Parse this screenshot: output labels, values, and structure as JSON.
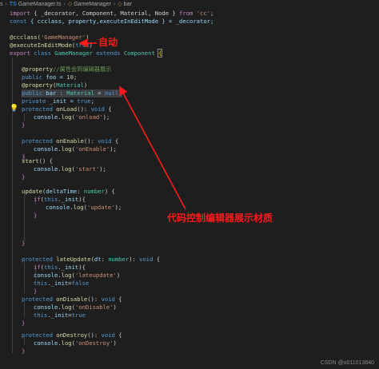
{
  "breadcrumb": {
    "items": [
      "s",
      "GameManager.ts",
      "GameManager",
      "bar"
    ],
    "ts_badge": "TS"
  },
  "code": {
    "l1": [
      "import",
      " { _decorator, Component, Material, Node } ",
      "from",
      " ",
      "'cc'",
      ";"
    ],
    "l2": [
      "const",
      " { ccclass, property,executeInEditMode } = _decorator;"
    ],
    "l4": [
      "@ccclass(",
      "'GameManager'",
      ")"
    ],
    "l5": [
      "@executeInEditMode(",
      "true",
      ")"
    ],
    "l6": [
      "export",
      " ",
      "class",
      " ",
      "GameManager",
      " ",
      "extends",
      " ",
      "Component",
      " ",
      "{"
    ],
    "l8": [
      "@property",
      "//属性会到编辑器展示"
    ],
    "l9": [
      "public",
      " foo = ",
      "10",
      ";"
    ],
    "l10": [
      "@property(",
      "Material",
      ")"
    ],
    "l11": [
      "public",
      " bar : ",
      "Material",
      " = ",
      "null",
      ";"
    ],
    "l12": [
      "private",
      " _init = ",
      "true",
      ";"
    ],
    "l13": [
      "protected",
      " ",
      "onLoad",
      "(): ",
      "void",
      " {"
    ],
    "l14": [
      "console",
      ".",
      "log",
      "(",
      "'onload'",
      ");"
    ],
    "l15": [
      "}"
    ],
    "l17": [
      "protected",
      " ",
      "onEnable",
      "(): ",
      "void",
      " {"
    ],
    "l18": [
      "console",
      ".",
      "log",
      "(",
      "'onEnable'",
      ");"
    ],
    "l19": [
      "}"
    ],
    "l21": [
      "start",
      "() {"
    ],
    "l22": [
      "console",
      ".",
      "log",
      "(",
      "'start'",
      ");"
    ],
    "l23": [
      "}"
    ],
    "l25": [
      "update",
      "(",
      "deltaTime",
      ": ",
      "number",
      ") {"
    ],
    "l26": [
      "if",
      "(",
      "this",
      ".",
      "_init",
      "){"
    ],
    "l27": [
      "console",
      ".",
      "log",
      "(",
      "'update'",
      ");"
    ],
    "l28": [
      "}"
    ],
    "l31": [
      "}"
    ],
    "l33": [
      "protected",
      " ",
      "lateUpdate",
      "(",
      "dt",
      ": ",
      "number",
      "): ",
      "void",
      " {"
    ],
    "l34": [
      "if",
      "(",
      "this",
      ".",
      "_init",
      "){"
    ],
    "l35": [
      "console",
      ".",
      "log",
      "(",
      "'lateupdate'",
      ")"
    ],
    "l36": [
      "this",
      ".",
      "_init",
      "=",
      "false"
    ],
    "l37": [
      "}"
    ],
    "l38": [
      "protected",
      " ",
      "onDisable",
      "(): ",
      "void",
      " {"
    ],
    "l39": [
      "console",
      ".",
      "log",
      "(",
      "'onDisable'",
      ")"
    ],
    "l40": [
      "this",
      ".",
      "_init",
      "=",
      "true"
    ],
    "l41": [
      "}"
    ],
    "l43": [
      "protected",
      " ",
      "onDestroy",
      "(): ",
      "void",
      " {"
    ],
    "l44": [
      "console",
      ".",
      "log",
      "(",
      "'onDestroy'",
      ")"
    ],
    "l45": [
      "}"
    ]
  },
  "annotations": {
    "auto": "自动",
    "editor_material": "代码控制编辑器展示材质",
    "color": "#ff1a1a"
  },
  "watermark": "CSDN @u011013840"
}
